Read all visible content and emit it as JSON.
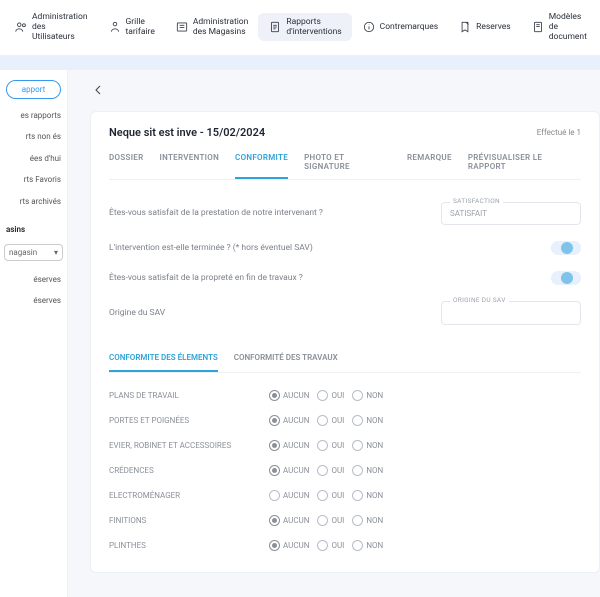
{
  "topbar": [
    {
      "icon": "users",
      "label": "Administration des Utilisateurs"
    },
    {
      "icon": "rate",
      "label": "Grille tarifaire"
    },
    {
      "icon": "stores",
      "label": "Administration des Magasins"
    },
    {
      "icon": "doc",
      "label": "Rapports d'interventions",
      "active": true
    },
    {
      "icon": "info",
      "label": "Contremarques"
    },
    {
      "icon": "bookmark",
      "label": "Reserves"
    },
    {
      "icon": "template",
      "label": "Modèles de document"
    }
  ],
  "sidebar": {
    "pill": "apport",
    "items": [
      "es rapports",
      "rts non és",
      "ées d'hui",
      "rts Favoris",
      "rts archivés"
    ],
    "section": "asins",
    "select": "nagasin",
    "items2": [
      "éserves",
      "éserves"
    ]
  },
  "card": {
    "title": "Neque sit est inve - 15/02/2024",
    "date": "Effectué le 1"
  },
  "tabs": [
    "DOSSIER",
    "INTERVENTION",
    "CONFORMITE",
    "PHOTO ET SIGNATURE",
    "REMARQUE",
    "PRÉVISUALISER LE RAPPORT"
  ],
  "activeTab": 2,
  "questions": {
    "q1": "Êtes-vous satisfait de la prestation de notre intervenant ?",
    "q2": "L'intervention est-elle terminée ? (* hors éventuel SAV)",
    "q3": "Êtes-vous satisfait de la propreté en fin de travaux ?",
    "q4": "Origine du SAV",
    "satisfactionLabel": "SATISFACTION",
    "satisfactionValue": "SATISFAIT",
    "origineLabel": "ORIGINE DU SAV"
  },
  "subtabs": [
    "CONFORMITE DES ÉLEMENTS",
    "CONFORMITÉ DES TRAVAUX"
  ],
  "activeSubtab": 0,
  "radioLabels": {
    "aucun": "AUCUN",
    "oui": "OUI",
    "non": "NON"
  },
  "elements": [
    {
      "name": "PLANS DE TRAVAIL",
      "value": "aucun"
    },
    {
      "name": "PORTES ET POIGNÉES",
      "value": "aucun"
    },
    {
      "name": "EVIER, ROBINET ET ACCESSOIRES",
      "value": "aucun"
    },
    {
      "name": "CRÉDENCES",
      "value": "aucun"
    },
    {
      "name": "ELECTROMÉNAGER",
      "value": null
    },
    {
      "name": "FINITIONS",
      "value": "aucun"
    },
    {
      "name": "PLINTHES",
      "value": "aucun"
    }
  ]
}
